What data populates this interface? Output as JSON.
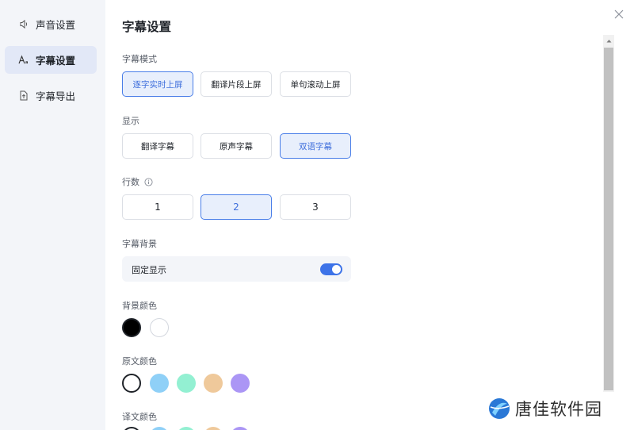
{
  "sidebar": {
    "items": [
      {
        "label": "声音设置",
        "icon": "speaker-icon"
      },
      {
        "label": "字幕设置",
        "icon": "font-icon"
      },
      {
        "label": "字幕导出",
        "icon": "export-icon"
      }
    ],
    "active_index": 1
  },
  "main": {
    "title": "字幕设置",
    "mode": {
      "label": "字幕模式",
      "options": [
        "逐字实时上屏",
        "翻译片段上屏",
        "单句滚动上屏"
      ],
      "selected_index": 0
    },
    "display": {
      "label": "显示",
      "options": [
        "翻译字幕",
        "原声字幕",
        "双语字幕"
      ],
      "selected_index": 2
    },
    "lines": {
      "label": "行数",
      "options": [
        "1",
        "2",
        "3"
      ],
      "selected_index": 1
    },
    "background": {
      "label": "字幕背景",
      "toggle_label": "固定显示",
      "toggle_on": true
    },
    "bg_color": {
      "label": "背景颜色",
      "colors": [
        "#000000",
        "#ffffff"
      ],
      "selected_index": 0
    },
    "source_color": {
      "label": "原文颜色",
      "colors": [
        "#ffffff",
        "#8fd0f7",
        "#93f0d2",
        "#efc99b",
        "#ab96f5"
      ],
      "selected_index": 0
    },
    "translation_color": {
      "label": "译文颜色"
    }
  },
  "watermark": {
    "text": "唐佳软件园"
  },
  "colors": {
    "accent": "#3d73e8",
    "sidebar_bg": "#f3f5f9",
    "selected_bg": "#e8effc"
  }
}
